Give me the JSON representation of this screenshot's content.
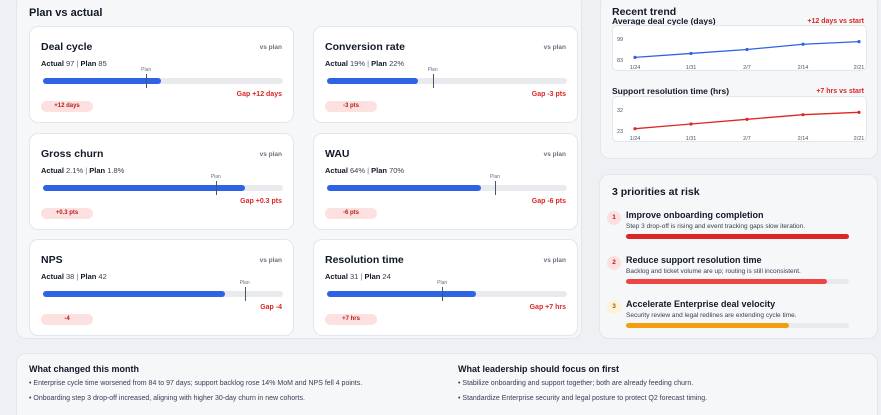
{
  "plan_vs_actual": {
    "title": "Plan vs actual",
    "metrics": [
      {
        "name": "Deal cycle",
        "vs": "vs plan",
        "actual_label": "Actual",
        "actual": "97",
        "plan_label": "Plan",
        "plan": "85",
        "marker_label": "Plan",
        "gap": "Gap +12 days",
        "pill": "+12 days",
        "actual_fraction": 0.49,
        "plan_fraction": 0.43
      },
      {
        "name": "Conversion rate",
        "vs": "vs plan",
        "actual_label": "Actual",
        "actual": "19%",
        "plan_label": "Plan",
        "plan": "22%",
        "marker_label": "Plan",
        "gap": "Gap -3 pts",
        "pill": "-3 pts",
        "actual_fraction": 0.38,
        "plan_fraction": 0.44
      },
      {
        "name": "Gross churn",
        "vs": "vs plan",
        "actual_label": "Actual",
        "actual": "2.1%",
        "plan_label": "Plan",
        "plan": "1.8%",
        "marker_label": "Plan",
        "gap": "Gap +0.3 pts",
        "pill": "+0.3 pts",
        "actual_fraction": 0.84,
        "plan_fraction": 0.72
      },
      {
        "name": "WAU",
        "vs": "vs plan",
        "actual_label": "Actual",
        "actual": "64%",
        "plan_label": "Plan",
        "plan": "70%",
        "marker_label": "Plan",
        "gap": "Gap -6 pts",
        "pill": "-6 pts",
        "actual_fraction": 0.64,
        "plan_fraction": 0.7
      },
      {
        "name": "NPS",
        "vs": "vs plan",
        "actual_label": "Actual",
        "actual": "38",
        "plan_label": "Plan",
        "plan": "42",
        "marker_label": "Plan",
        "gap": "Gap -4",
        "pill": "-4",
        "actual_fraction": 0.76,
        "plan_fraction": 0.84
      },
      {
        "name": "Resolution time",
        "vs": "vs plan",
        "actual_label": "Actual",
        "actual": "31",
        "plan_label": "Plan",
        "plan": "24",
        "marker_label": "Plan",
        "gap": "Gap +7 hrs",
        "pill": "+7 hrs",
        "actual_fraction": 0.62,
        "plan_fraction": 0.48
      }
    ]
  },
  "recent_trend": {
    "title": "Recent trend",
    "charts": [
      {
        "subtitle": "Average deal cycle (days)",
        "delta": "+12 days vs start",
        "y_labels": [
          "99",
          "83"
        ],
        "x_labels": [
          "1/24",
          "1/31",
          "2/7",
          "2/14",
          "2/21"
        ],
        "values": [
          85,
          88,
          91,
          95,
          97
        ],
        "ylim": [
          83,
          99
        ],
        "color": "#2f63e6"
      },
      {
        "subtitle": "Support resolution time (hrs)",
        "delta": "+7 hrs vs start",
        "y_labels": [
          "32",
          "23"
        ],
        "x_labels": [
          "1/24",
          "1/31",
          "2/7",
          "2/14",
          "2/21"
        ],
        "values": [
          24,
          26,
          28,
          30,
          31
        ],
        "ylim": [
          23,
          32
        ],
        "color": "#dc2626"
      }
    ]
  },
  "priorities": {
    "title": "3 priorities at risk",
    "items": [
      {
        "num": "1",
        "name": "Improve onboarding completion",
        "desc": "Step 3 drop-off is rising and event tracking gaps slow iteration.",
        "fraction": 1.0,
        "color": "#dc2626",
        "badge_bg": "#fde0e0",
        "badge_fg": "#b91c1c"
      },
      {
        "num": "2",
        "name": "Reduce support resolution time",
        "desc": "Backlog and ticket volume are up; routing is still inconsistent.",
        "fraction": 0.9,
        "color": "#ef4444",
        "badge_bg": "#fde0e0",
        "badge_fg": "#b91c1c"
      },
      {
        "num": "3",
        "name": "Accelerate Enterprise deal velocity",
        "desc": "Security review and legal redlines are extending cycle time.",
        "fraction": 0.73,
        "color": "#f59e0b",
        "badge_bg": "#fdf1d8",
        "badge_fg": "#b45309"
      }
    ]
  },
  "bottom": {
    "changed": {
      "title": "What changed this month",
      "items": [
        "Enterprise cycle time worsened from 84 to 97 days; support backlog rose 14% MoM and NPS fell 4 points.",
        "Onboarding step 3 drop-off increased, aligning with higher 30-day churn in new cohorts."
      ]
    },
    "focus": {
      "title": "What leadership should focus on first",
      "items": [
        "Stabilize onboarding and support together; both are already feeding churn.",
        "Standardize Enterprise security and legal posture to protect Q2 forecast timing."
      ]
    }
  }
}
